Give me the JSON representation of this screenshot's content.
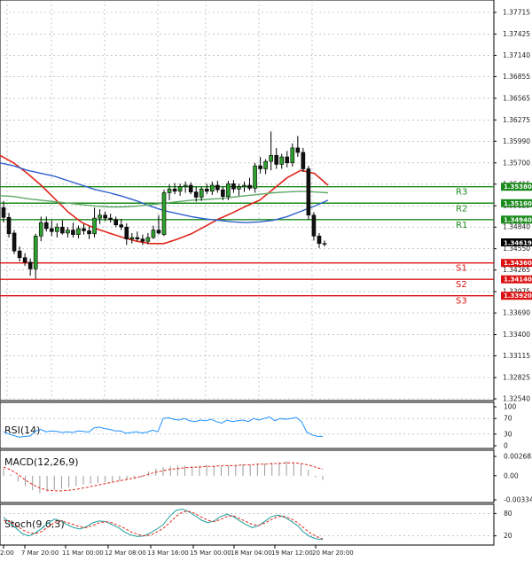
{
  "chart_data": [
    {
      "type": "candlestick",
      "ylim": [
        1.3254,
        1.37715
      ],
      "y_ticks": [
        "1.37715",
        "1.37425",
        "1.37140",
        "1.36855",
        "1.36565",
        "1.36275",
        "1.35990",
        "1.35700",
        "1.35415",
        "1.35125",
        "1.34840",
        "1.34550",
        "1.34265",
        "1.33975",
        "1.33690",
        "1.33400",
        "1.33115",
        "1.32825",
        "1.32540"
      ],
      "x_ticks": [
        "2:00",
        "7 Mar 20:00",
        "11 Mar 00:00",
        "12 Mar 08:00",
        "13 Mar 16:00",
        "15 Mar 00:00",
        "18 Mar 04:00",
        "19 Mar 12:00",
        "20 Mar 20:00"
      ],
      "last_price": "1.34619",
      "levels": [
        {
          "name": "R3",
          "value": 1.3538,
          "label": "1.35380",
          "color": "#1a8a1a",
          "tag_color": "#1a8a1a"
        },
        {
          "name": "R2",
          "value": 1.3516,
          "label": "1.35160",
          "color": "#1a8a1a",
          "tag_color": "#1a8a1a"
        },
        {
          "name": "R1",
          "value": 1.3494,
          "label": "1.34940",
          "color": "#1a8a1a",
          "tag_color": "#1a8a1a"
        },
        {
          "name": "S1",
          "value": 1.3436,
          "label": "1.34360",
          "color": "#dd1111",
          "tag_color": "#dd1111"
        },
        {
          "name": "S2",
          "value": 1.3414,
          "label": "1.34140",
          "color": "#dd1111",
          "tag_color": "#dd1111"
        },
        {
          "name": "S3",
          "value": 1.3392,
          "label": "1.33920",
          "color": "#dd1111",
          "tag_color": "#dd1111"
        }
      ],
      "candles": [
        [
          1.351,
          1.3519,
          1.349,
          1.3497
        ],
        [
          1.3497,
          1.3503,
          1.347,
          1.3475
        ],
        [
          1.3476,
          1.348,
          1.3448,
          1.3452
        ],
        [
          1.3452,
          1.3458,
          1.3438,
          1.3443
        ],
        [
          1.3443,
          1.3449,
          1.3432,
          1.3437
        ],
        [
          1.3437,
          1.3442,
          1.3419,
          1.3428
        ],
        [
          1.3428,
          1.3475,
          1.3415,
          1.3472
        ],
        [
          1.3472,
          1.3498,
          1.3465,
          1.349
        ],
        [
          1.349,
          1.3498,
          1.3478,
          1.3482
        ],
        [
          1.3482,
          1.3493,
          1.3472,
          1.3478
        ],
        [
          1.3478,
          1.3489,
          1.347,
          1.3484
        ],
        [
          1.3484,
          1.3493,
          1.3474,
          1.3476
        ],
        [
          1.3476,
          1.3484,
          1.347,
          1.348
        ],
        [
          1.348,
          1.349,
          1.347,
          1.3474
        ],
        [
          1.3474,
          1.3486,
          1.3469,
          1.3482
        ],
        [
          1.3482,
          1.3488,
          1.3474,
          1.3479
        ],
        [
          1.3479,
          1.3485,
          1.3468,
          1.3475
        ],
        [
          1.3475,
          1.351,
          1.347,
          1.3496
        ],
        [
          1.3496,
          1.3508,
          1.3488,
          1.35
        ],
        [
          1.35,
          1.3505,
          1.3492,
          1.3496
        ],
        [
          1.3496,
          1.3502,
          1.349,
          1.3494
        ],
        [
          1.3494,
          1.3498,
          1.3484,
          1.3487
        ],
        [
          1.3487,
          1.3495,
          1.348,
          1.3484
        ],
        [
          1.3484,
          1.3489,
          1.346,
          1.3468
        ],
        [
          1.3468,
          1.3476,
          1.3462,
          1.347
        ],
        [
          1.347,
          1.3478,
          1.3465,
          1.3468
        ],
        [
          1.3468,
          1.3474,
          1.346,
          1.3465
        ],
        [
          1.3465,
          1.3476,
          1.3461,
          1.347
        ],
        [
          1.347,
          1.3486,
          1.3468,
          1.348
        ],
        [
          1.348,
          1.35,
          1.3474,
          1.3476
        ],
        [
          1.3474,
          1.3534,
          1.3472,
          1.353
        ],
        [
          1.353,
          1.3541,
          1.352,
          1.3535
        ],
        [
          1.3535,
          1.3543,
          1.3528,
          1.3532
        ],
        [
          1.3532,
          1.3542,
          1.3526,
          1.3538
        ],
        [
          1.3538,
          1.3545,
          1.353,
          1.354
        ],
        [
          1.354,
          1.3544,
          1.3528,
          1.3531
        ],
        [
          1.3531,
          1.3538,
          1.3518,
          1.3524
        ],
        [
          1.3524,
          1.3538,
          1.3519,
          1.3535
        ],
        [
          1.3535,
          1.3542,
          1.3528,
          1.3532
        ],
        [
          1.3532,
          1.3545,
          1.3527,
          1.354
        ],
        [
          1.354,
          1.3546,
          1.353,
          1.3534
        ],
        [
          1.3534,
          1.3538,
          1.352,
          1.3525
        ],
        [
          1.3525,
          1.3546,
          1.352,
          1.3542
        ],
        [
          1.3542,
          1.3547,
          1.353,
          1.3535
        ],
        [
          1.3535,
          1.3542,
          1.3526,
          1.3538
        ],
        [
          1.3538,
          1.3545,
          1.3531,
          1.354
        ],
        [
          1.354,
          1.355,
          1.3533,
          1.3536
        ],
        [
          1.3536,
          1.357,
          1.353,
          1.3566
        ],
        [
          1.3566,
          1.3578,
          1.3556,
          1.3562
        ],
        [
          1.3562,
          1.3575,
          1.3555,
          1.3572
        ],
        [
          1.3572,
          1.3612,
          1.356,
          1.358
        ],
        [
          1.358,
          1.359,
          1.3562,
          1.3568
        ],
        [
          1.3568,
          1.3582,
          1.3562,
          1.3578
        ],
        [
          1.3578,
          1.3586,
          1.3564,
          1.357
        ],
        [
          1.357,
          1.3596,
          1.3565,
          1.359
        ],
        [
          1.359,
          1.3606,
          1.3578,
          1.3584
        ],
        [
          1.3584,
          1.359,
          1.3558,
          1.3562
        ],
        [
          1.3562,
          1.3566,
          1.3494,
          1.35
        ],
        [
          1.35,
          1.3504,
          1.3466,
          1.3472
        ],
        [
          1.3472,
          1.3476,
          1.3456,
          1.3462
        ],
        [
          1.3462,
          1.3466,
          1.3458,
          1.3462
        ]
      ],
      "ma": [
        {
          "name": "red",
          "color": "#e0261b",
          "width": 1.6,
          "values": [
            1.358,
            1.357,
            1.3556,
            1.354,
            1.3522,
            1.3504,
            1.349,
            1.3482,
            1.3476,
            1.347,
            1.3465,
            1.3462,
            1.3462,
            1.3468,
            1.3475,
            1.3485,
            1.3495,
            1.3503,
            1.3512,
            1.352,
            1.3535,
            1.355,
            1.356,
            1.3556,
            1.354
          ]
        },
        {
          "name": "blue",
          "color": "#2f5fd0",
          "width": 1.4,
          "values": [
            1.357,
            1.3566,
            1.356,
            1.3556,
            1.3552,
            1.3546,
            1.354,
            1.3534,
            1.353,
            1.3525,
            1.3519,
            1.3512,
            1.3506,
            1.3502,
            1.3498,
            1.3495,
            1.3493,
            1.3491,
            1.349,
            1.3491,
            1.3493,
            1.3498,
            1.3505,
            1.3512,
            1.352
          ]
        },
        {
          "name": "green",
          "color": "#5fa868",
          "width": 1.4,
          "values": [
            1.3526,
            1.3525,
            1.3522,
            1.352,
            1.3518,
            1.3516,
            1.3514,
            1.3512,
            1.3511,
            1.3511,
            1.3512,
            1.3514,
            1.3516,
            1.3518,
            1.352,
            1.3521,
            1.3522,
            1.3524,
            1.3526,
            1.3528,
            1.353,
            1.3531,
            1.3532,
            1.3531,
            1.353
          ]
        }
      ]
    },
    {
      "type": "line",
      "title": "RSI(14)",
      "ylim": [
        0,
        100
      ],
      "y_ticks": [
        "100",
        "70",
        "30",
        "0"
      ],
      "values": [
        36,
        30,
        26,
        22,
        24,
        25,
        38,
        42,
        36,
        38,
        37,
        34,
        36,
        34,
        38,
        37,
        35,
        46,
        48,
        44,
        42,
        38,
        38,
        32,
        34,
        36,
        33,
        35,
        40,
        36,
        70,
        72,
        68,
        66,
        70,
        64,
        62,
        66,
        64,
        68,
        62,
        58,
        66,
        62,
        64,
        66,
        62,
        70,
        66,
        70,
        74,
        64,
        70,
        68,
        70,
        73,
        62,
        35,
        28,
        24,
        24
      ]
    },
    {
      "type": "bar",
      "title": "MACD(12,26,9)",
      "ylim": [
        -0.003346,
        0.002683
      ],
      "y_ticks": [
        "0.002683",
        "0.00",
        "-0.003346"
      ],
      "histogram": [
        0.001,
        0.0002,
        -0.0008,
        -0.0014,
        -0.002,
        -0.0024,
        -0.0022,
        -0.002,
        -0.0018,
        -0.0016,
        -0.0014,
        -0.0012,
        -0.0011,
        -0.001,
        -0.0009,
        -0.0008,
        -0.0007,
        -0.0006,
        -0.0004,
        -0.0002,
        0.0006,
        0.001,
        0.0012,
        0.0013,
        0.0014,
        0.0014,
        0.0013,
        0.0014,
        0.0015,
        0.0014,
        0.0013,
        0.0014,
        0.0015,
        0.0016,
        0.0016,
        0.0016,
        0.0017,
        0.0018,
        0.0019,
        0.002,
        0.0018,
        0.0016,
        0.0008,
        -0.0002,
        -0.0006
      ],
      "signal": [
        0.0012,
        0.0008,
        0.0002,
        -0.0006,
        -0.0012,
        -0.0017,
        -0.002,
        -0.0021,
        -0.0021,
        -0.002,
        -0.0019,
        -0.0017,
        -0.0015,
        -0.0013,
        -0.0011,
        -0.0009,
        -0.0007,
        -0.0005,
        -0.0003,
        -0.0001,
        0.0002,
        0.0005,
        0.0007,
        0.0009,
        0.001,
        0.0011,
        0.0012,
        0.0012,
        0.0013,
        0.0013,
        0.0014,
        0.0014,
        0.0014,
        0.0015,
        0.0015,
        0.0016,
        0.0016,
        0.0017,
        0.0017,
        0.0018,
        0.0018,
        0.0017,
        0.0015,
        0.0012,
        0.0009
      ]
    },
    {
      "type": "line",
      "title": "Stoch(9,6,3)",
      "ylim": [
        0,
        100
      ],
      "y_ticks": [
        "80",
        "20"
      ],
      "main": [
        70,
        55,
        40,
        25,
        20,
        28,
        40,
        55,
        65,
        60,
        50,
        42,
        38,
        45,
        55,
        60,
        58,
        50,
        42,
        30,
        22,
        18,
        20,
        28,
        38,
        50,
        72,
        88,
        92,
        85,
        74,
        62,
        55,
        60,
        72,
        78,
        72,
        60,
        50,
        42,
        48,
        60,
        72,
        76,
        70,
        60,
        48,
        30,
        18,
        12,
        10
      ],
      "signal": [
        62,
        58,
        48,
        36,
        28,
        26,
        32,
        44,
        56,
        60,
        56,
        50,
        44,
        42,
        48,
        55,
        58,
        55,
        48,
        40,
        30,
        24,
        20,
        22,
        30,
        40,
        55,
        72,
        84,
        86,
        80,
        70,
        62,
        58,
        64,
        72,
        74,
        66,
        58,
        50,
        48,
        55,
        64,
        72,
        72,
        66,
        56,
        42,
        28,
        18,
        12
      ]
    }
  ]
}
